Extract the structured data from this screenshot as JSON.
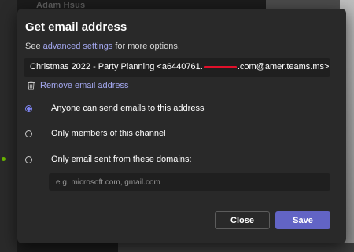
{
  "background": {
    "top_text": "Adam Hsus"
  },
  "dialog": {
    "title": "Get email address",
    "subtitle_prefix": "See ",
    "subtitle_link": "advanced settings",
    "subtitle_suffix": " for more options.",
    "email_prefix": "Christmas 2022 - Party Planning <a6440761.",
    "email_suffix": ".com@amer.teams.ms>",
    "remove_label": "Remove email address",
    "options": [
      {
        "label": "Anyone can send emails to this address",
        "checked": true
      },
      {
        "label": "Only members of this channel",
        "checked": false
      },
      {
        "label": "Only email sent from these domains:",
        "checked": false
      }
    ],
    "domains_placeholder": "e.g. microsoft.com, gmail.com",
    "close_label": "Close",
    "save_label": "Save"
  },
  "colors": {
    "accent": "#6264c5",
    "link": "#a4a8f0",
    "dialog_bg": "#292929",
    "redaction": "#e0102a"
  }
}
